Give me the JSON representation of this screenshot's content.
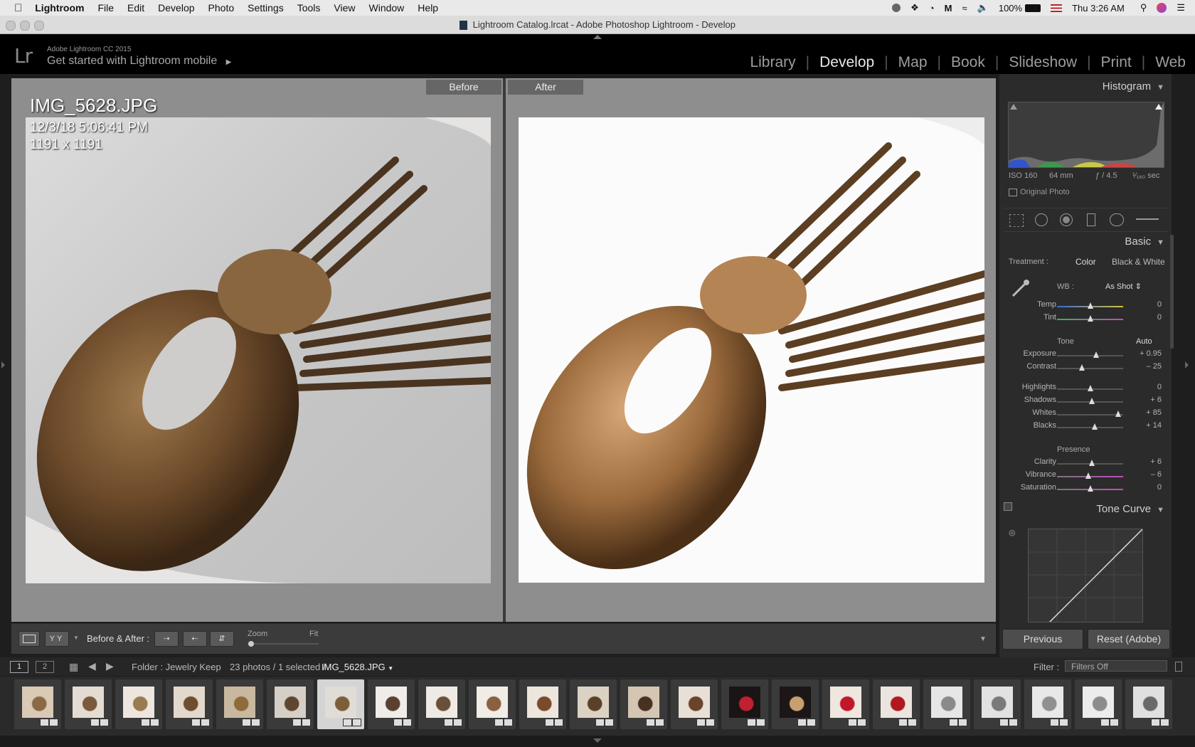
{
  "menubar": {
    "app": "Lightroom",
    "items": [
      "File",
      "Edit",
      "Develop",
      "Photo",
      "Settings",
      "Tools",
      "View",
      "Window",
      "Help"
    ],
    "battery": "100%",
    "clock": "Thu 3:26 AM"
  },
  "window": {
    "title": "Lightroom Catalog.lrcat - Adobe Photoshop Lightroom - Develop"
  },
  "header": {
    "logo": "Lr",
    "product": "Adobe Lightroom CC 2015",
    "mobile": "Get started with Lightroom mobile",
    "modules": [
      "Library",
      "Develop",
      "Map",
      "Book",
      "Slideshow",
      "Print",
      "Web"
    ],
    "active_module": "Develop"
  },
  "view": {
    "before_label": "Before",
    "after_label": "After",
    "filename": "IMG_5628.JPG",
    "datetime": "12/3/18 5:06:41 PM",
    "dimensions": "1191 x 1191"
  },
  "toolbar": {
    "before_after_label": "Before & After :",
    "zoom_label": "Zoom",
    "fit_label": "Fit"
  },
  "histogram": {
    "title": "Histogram",
    "iso": "ISO 160",
    "focal": "64 mm",
    "aperture": "ƒ / 4.5",
    "shutter": "¹⁄₁₆₀ sec",
    "original_photo": "Original Photo"
  },
  "basic": {
    "title": "Basic",
    "treatment_label": "Treatment :",
    "color": "Color",
    "bw": "Black & White",
    "wb_label": "WB :",
    "wb_value": "As Shot ⇕",
    "tone_label": "Tone",
    "auto_label": "Auto",
    "presence_label": "Presence",
    "sliders_wb": [
      {
        "label": "Temp",
        "value": "0",
        "pos": 0.5
      },
      {
        "label": "Tint",
        "value": "0",
        "pos": 0.5
      }
    ],
    "sliders_tone1": [
      {
        "label": "Exposure",
        "value": "+ 0.95",
        "pos": 0.59
      },
      {
        "label": "Contrast",
        "value": "– 25",
        "pos": 0.38
      }
    ],
    "sliders_tone2": [
      {
        "label": "Highlights",
        "value": "0",
        "pos": 0.5
      },
      {
        "label": "Shadows",
        "value": "+ 6",
        "pos": 0.53
      },
      {
        "label": "Whites",
        "value": "+ 85",
        "pos": 0.92
      },
      {
        "label": "Blacks",
        "value": "+ 14",
        "pos": 0.57
      }
    ],
    "sliders_presence": [
      {
        "label": "Clarity",
        "value": "+ 6",
        "pos": 0.53
      },
      {
        "label": "Vibrance",
        "value": "– 6",
        "pos": 0.47
      },
      {
        "label": "Saturation",
        "value": "0",
        "pos": 0.5
      }
    ]
  },
  "tone_curve": {
    "title": "Tone Curve"
  },
  "panel_buttons": {
    "previous": "Previous",
    "reset": "Reset (Adobe)"
  },
  "filmstrip_bar": {
    "screen1": "1",
    "screen2": "2",
    "folder": "Folder : Jewelry Keep",
    "count": "23 photos / 1 selected /",
    "current": "IMG_5628.JPG",
    "filter_label": "Filter :",
    "filter_value": "Filters Off"
  },
  "thumbs": [
    {
      "tone": "#d9c9b5",
      "accent": "#8a6a45"
    },
    {
      "tone": "#e4dcd2",
      "accent": "#7a5a3a"
    },
    {
      "tone": "#ece6df",
      "accent": "#9a7a50"
    },
    {
      "tone": "#e2d8cc",
      "accent": "#6e4e30"
    },
    {
      "tone": "#c8b8a0",
      "accent": "#8f6a3c"
    },
    {
      "tone": "#d6cfc8",
      "accent": "#5e4630"
    },
    {
      "tone": "#e0dcd6",
      "accent": "#7d5e3a"
    },
    {
      "tone": "#f0ede8",
      "accent": "#5a4030"
    },
    {
      "tone": "#efeae4",
      "accent": "#6a5038"
    },
    {
      "tone": "#f1ece6",
      "accent": "#8a6040"
    },
    {
      "tone": "#ede6dd",
      "accent": "#7a4a2a"
    },
    {
      "tone": "#dcd2c4",
      "accent": "#5a4028"
    },
    {
      "tone": "#d4c6b2",
      "accent": "#4a3020"
    },
    {
      "tone": "#e8e0d6",
      "accent": "#6a4428"
    },
    {
      "tone": "#1a1414",
      "accent": "#c02030"
    },
    {
      "tone": "#1c1616",
      "accent": "#c8a070"
    },
    {
      "tone": "#efe6e0",
      "accent": "#c01828"
    },
    {
      "tone": "#ece4de",
      "accent": "#b01820"
    },
    {
      "tone": "#e6e6e6",
      "accent": "#8a8a8a"
    },
    {
      "tone": "#e2e2e2",
      "accent": "#7a7a7a"
    },
    {
      "tone": "#e8e8e8",
      "accent": "#909090"
    },
    {
      "tone": "#ececec",
      "accent": "#8c8c8c"
    },
    {
      "tone": "#e0e0e0",
      "accent": "#6a6a6a"
    }
  ]
}
